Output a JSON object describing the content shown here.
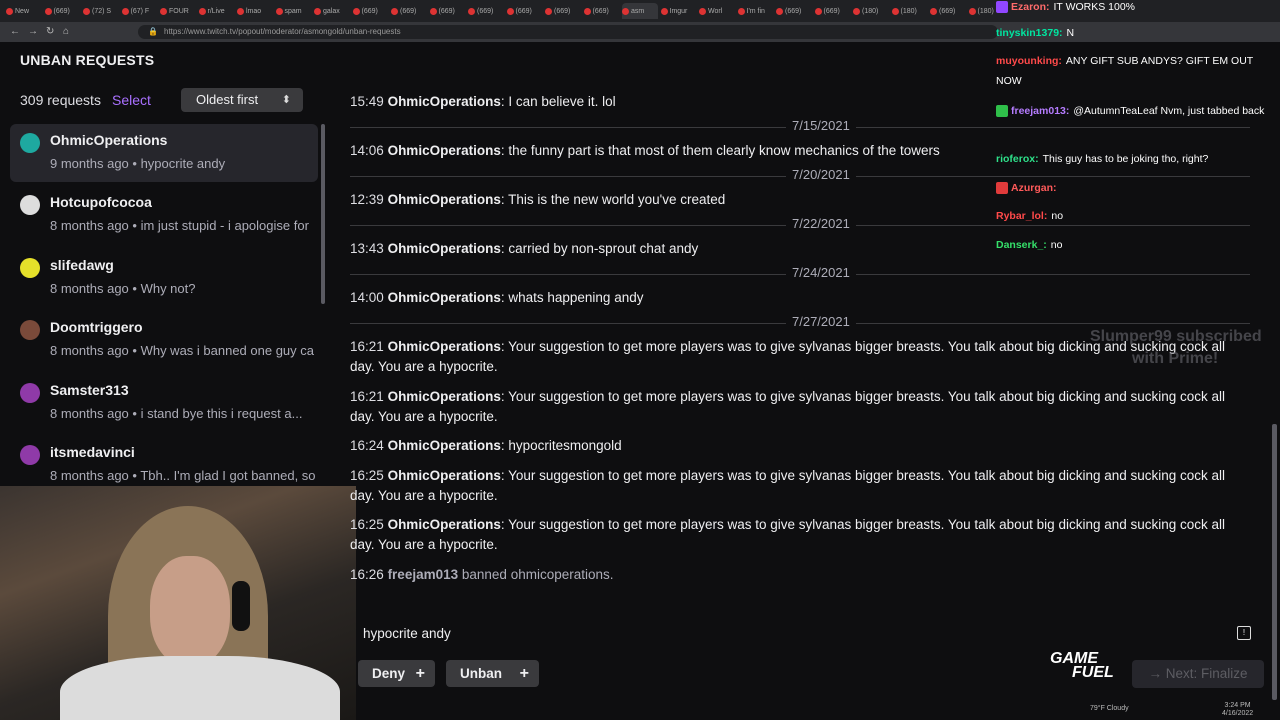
{
  "browser": {
    "tabs": [
      "New",
      "(669)",
      "(72) S",
      "(67) F",
      "FOUR",
      "r/Live",
      "lmao",
      "spam",
      "galax",
      "(669)",
      "(669)",
      "(669)",
      "(669)",
      "(669)",
      "(669)",
      "(669)",
      "asm",
      "Imgur",
      "Worl",
      "I'm fin",
      "(669)",
      "(669)",
      "(180)",
      "(180)",
      "(669)",
      "(180)"
    ],
    "active_tab_index": 16,
    "url": "https://www.twitch.tv/popout/moderator/asmongold/unban-requests"
  },
  "page": {
    "title": "UNBAN REQUESTS",
    "count_label": "309 requests",
    "select_label": "Select",
    "sort_label": "Oldest first"
  },
  "requests": [
    {
      "name": "OhmicOperations",
      "time": "9 months ago",
      "text": "hypocrite andy",
      "avatar_color": "#1ea9a0"
    },
    {
      "name": "Hotcupofcocoa",
      "time": "8 months ago",
      "text": "im just stupid - i apologise for",
      "avatar_color": "#dddddd"
    },
    {
      "name": "slifedawg",
      "time": "8 months ago",
      "text": "Why not?",
      "avatar_color": "#e5e02a"
    },
    {
      "name": "Doomtriggero",
      "time": "8 months ago",
      "text": "Why was i banned one guy ca",
      "avatar_color": "#7a4a3a"
    },
    {
      "name": "Samster313",
      "time": "8 months ago",
      "text": "i stand bye this i request a...",
      "avatar_color": "#8f3aa8"
    },
    {
      "name": "itsmedavinci",
      "time": "8 months ago",
      "text": "Tbh.. I'm glad I got banned, so",
      "avatar_color": "#8f3aa8"
    }
  ],
  "log": {
    "entries": [
      {
        "kind": "msg",
        "time": "15:49",
        "user": "OhmicOperations",
        "text": "I can believe it. lol"
      },
      {
        "kind": "date",
        "date": "7/15/2021"
      },
      {
        "kind": "msg",
        "time": "14:06",
        "user": "OhmicOperations",
        "text": "the funny part is that most of them clearly know mechanics of the towers"
      },
      {
        "kind": "date",
        "date": "7/20/2021"
      },
      {
        "kind": "msg",
        "time": "12:39",
        "user": "OhmicOperations",
        "text": "This is the new world you've created"
      },
      {
        "kind": "date",
        "date": "7/22/2021"
      },
      {
        "kind": "msg",
        "time": "13:43",
        "user": "OhmicOperations",
        "text": "carried by non-sprout chat andy"
      },
      {
        "kind": "date",
        "date": "7/24/2021"
      },
      {
        "kind": "msg",
        "time": "14:00",
        "user": "OhmicOperations",
        "text": "whats happening andy"
      },
      {
        "kind": "date",
        "date": "7/27/2021"
      },
      {
        "kind": "msg",
        "time": "16:21",
        "user": "OhmicOperations",
        "text": "Your suggestion to get more players was to give sylvanas bigger breasts. You talk about big dicking and sucking cock all day. You are a hypocrite."
      },
      {
        "kind": "msg",
        "time": "16:21",
        "user": "OhmicOperations",
        "text": "Your suggestion to get more players was to give sylvanas bigger breasts. You talk about big dicking and sucking cock all day. You are a hypocrite."
      },
      {
        "kind": "msg",
        "time": "16:24",
        "user": "OhmicOperations",
        "text": "hypocritesmongold"
      },
      {
        "kind": "msg",
        "time": "16:25",
        "user": "OhmicOperations",
        "text": "Your suggestion to get more players was to give sylvanas bigger breasts. You talk about big dicking and sucking cock all day. You are a hypocrite."
      },
      {
        "kind": "msg",
        "time": "16:25",
        "user": "OhmicOperations",
        "text": "Your suggestion to get more players was to give sylvanas bigger breasts. You talk about big dicking and sucking cock all day. You are a hypocrite."
      },
      {
        "kind": "ban",
        "time": "16:26",
        "user": "freejam013",
        "text": "banned ohmicoperations."
      }
    ]
  },
  "request_text": "hypocrite andy",
  "actions": {
    "deny_label": "Deny",
    "unban_label": "Unban",
    "finalize_label": "Next: Finalize"
  },
  "overlay_chat": [
    {
      "user": "Ezaron:",
      "text": "IT WORKS 100%",
      "color": "#ff6b6b",
      "badge": "#9147ff"
    },
    {
      "user": "tinyskin1379:",
      "text": "N",
      "color": "#00e5a0",
      "badge": ""
    },
    {
      "user": "muyounking:",
      "text": "ANY GIFT SUB ANDYS? GIFT EM OUT NOW",
      "color": "#ff4a4a",
      "badge": ""
    },
    {
      "user": "freejam013:",
      "text": "@AutumnTeaLeaf Nvm, just tabbed back",
      "color": "#b57cff",
      "badge": "#2fbf4a"
    },
    {
      "user": "rioferox:",
      "text": "This guy has to be joking tho, right?",
      "color": "#2ee08a",
      "badge": ""
    },
    {
      "user": "Azurgan:",
      "text": "",
      "color": "#ff5a5a",
      "badge": "#e03b3b"
    },
    {
      "user": "Rybar_lol:",
      "text": "no",
      "color": "#ff4a4a",
      "badge": ""
    },
    {
      "user": "Danserk_:",
      "text": "no",
      "color": "#35e06a",
      "badge": ""
    }
  ],
  "sub_alert": {
    "line1": "Slumper99 subscribed",
    "line2": "with Prime!"
  },
  "brand": {
    "line1": "GAME",
    "line2": "FUEL"
  },
  "taskbar": {
    "weather": "79°F Cloudy",
    "time": "3:24 PM",
    "date": "4/16/2022"
  }
}
